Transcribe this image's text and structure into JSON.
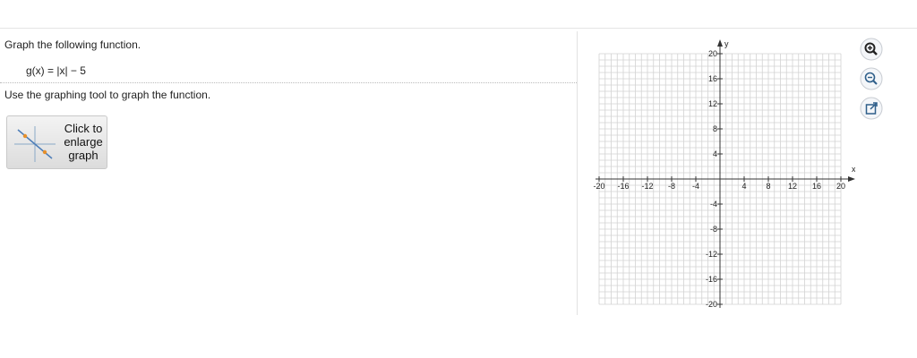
{
  "question": {
    "prompt": "Graph the following function.",
    "function": "g(x) = |x| − 5",
    "instruction": "Use the graphing tool to graph the function."
  },
  "enlarge_button": {
    "line1": "Click to",
    "line2": "enlarge",
    "line3": "graph"
  },
  "graph": {
    "x_axis_label": "x",
    "y_axis_label": "y",
    "x_ticks": [
      "-20",
      "-16",
      "-12",
      "-8",
      "-4",
      "4",
      "8",
      "12",
      "16",
      "20"
    ],
    "y_ticks": [
      "20",
      "16",
      "12",
      "8",
      "4",
      "-4",
      "-8",
      "-12",
      "-16",
      "-20"
    ],
    "range": {
      "xmin": -20,
      "xmax": 20,
      "ymin": -20,
      "ymax": 20,
      "minor_step": 1,
      "label_step": 4
    }
  },
  "tools": [
    "zoom-in-icon",
    "zoom-out-icon",
    "pop-out-icon"
  ],
  "colors": {
    "grid": "#d2d2d2",
    "axis": "#333333",
    "icon": "#2f5f8a",
    "accent_point": "#e8902a"
  }
}
